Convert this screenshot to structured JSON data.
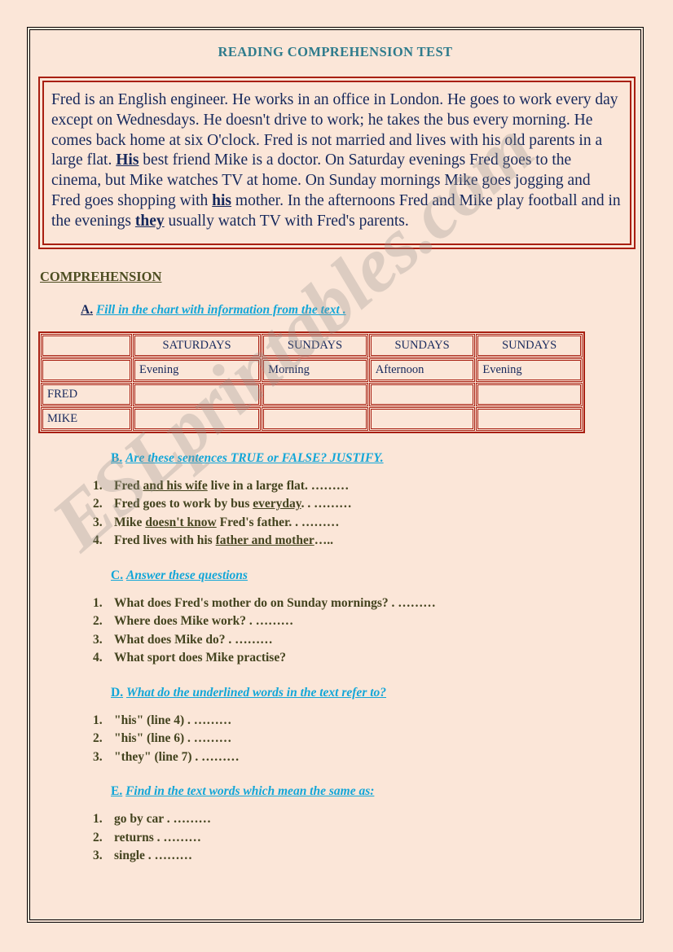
{
  "document": {
    "title": "READING COMPREHENSION TEST",
    "watermark": "ESLprintables.com",
    "colors": {
      "background": "#fbe6d8",
      "title_teal": "#2e7b8c",
      "passage_navy": "#16285c",
      "heading_olive": "#4d4d21",
      "question_olive": "#44441f",
      "accent_cyan": "#12a6d8",
      "border_red": "#a81f11",
      "page_border": "#000000"
    }
  },
  "passage": {
    "segments": [
      {
        "text": "Fred is an English engineer. He works in an office in London. He goes to work every day except on Wednesdays. He doesn't drive to work; he takes the bus every morning. He comes back home at six O'clock. Fred is not married and lives with his old parents in a large flat. ",
        "underlined": false
      },
      {
        "text": "His",
        "underlined": true
      },
      {
        "text": " best friend Mike is a doctor. On Saturday evenings Fred goes to the cinema, but Mike watches TV at home. On Sunday mornings Mike goes jogging and Fred goes shopping with ",
        "underlined": false
      },
      {
        "text": "his",
        "underlined": true
      },
      {
        "text": " mother. In the afternoons Fred and Mike play football and in the evenings ",
        "underlined": false
      },
      {
        "text": "they",
        "underlined": true
      },
      {
        "text": " usually watch TV with Fred's parents.",
        "underlined": false
      }
    ]
  },
  "comprehension": {
    "heading": "COMPREHENSION"
  },
  "section_a": {
    "letter": "A.",
    "title": "Fill in the chart with information from the text ."
  },
  "chart_data": {
    "type": "table",
    "title": "Fill in the chart with information from the text",
    "corner_label": "",
    "day_headers": [
      "SATURDAYS",
      "SUNDAYS",
      "SUNDAYS",
      "SUNDAYS"
    ],
    "part_headers": [
      "Evening",
      "Morning",
      "Afternoon",
      "Evening"
    ],
    "rows": [
      {
        "name": "FRED",
        "cells": [
          "",
          "",
          "",
          ""
        ]
      },
      {
        "name": "MIKE",
        "cells": [
          "",
          "",
          "",
          ""
        ]
      }
    ]
  },
  "section_b": {
    "letter": "B.",
    "title": "Are these sentences TRUE or FALSE? JUSTIFY.",
    "items": [
      [
        {
          "text": "Fred ",
          "underlined": false
        },
        {
          "text": "and his wife",
          "underlined": true
        },
        {
          "text": " live in a large flat. ………",
          "underlined": false
        }
      ],
      [
        {
          "text": "Fred goes to work by bus ",
          "underlined": false
        },
        {
          "text": "everyday",
          "underlined": true
        },
        {
          "text": ". . ………",
          "underlined": false
        }
      ],
      [
        {
          "text": "Mike ",
          "underlined": false
        },
        {
          "text": "doesn't know",
          "underlined": true
        },
        {
          "text": " Fred's father. . ………",
          "underlined": false
        }
      ],
      [
        {
          "text": "Fred lives with his ",
          "underlined": false
        },
        {
          "text": "father and mother",
          "underlined": true
        },
        {
          "text": "…..",
          "underlined": false
        }
      ]
    ]
  },
  "section_c": {
    "letter": "C.",
    "title": "Answer these questions",
    "items": [
      [
        {
          "text": "What does Fred's mother do on Sunday mornings? . ………",
          "underlined": false
        }
      ],
      [
        {
          "text": "Where does Mike work? . ………",
          "underlined": false
        }
      ],
      [
        {
          "text": "What does Mike do? . ………",
          "underlined": false
        }
      ],
      [
        {
          "text": "What sport does Mike practise?",
          "underlined": false
        }
      ]
    ]
  },
  "section_d": {
    "letter": "D.",
    "title": "What do the underlined words in the text refer to?",
    "items": [
      [
        {
          "text": "\"his\" (line 4)    . ………",
          "underlined": false
        }
      ],
      [
        {
          "text": "\"his\" (line 6)    . ………",
          "underlined": false
        }
      ],
      [
        {
          "text": "\"they\" (line 7)   . ………",
          "underlined": false
        }
      ]
    ]
  },
  "section_e": {
    "letter": "E.",
    "title": "Find in the text words which mean the same as:",
    "items": [
      [
        {
          "text": "go by car    . ………",
          "underlined": false
        }
      ],
      [
        {
          "text": "returns    . ………",
          "underlined": false
        }
      ],
      [
        {
          "text": "single   . ………",
          "underlined": false
        }
      ]
    ]
  }
}
